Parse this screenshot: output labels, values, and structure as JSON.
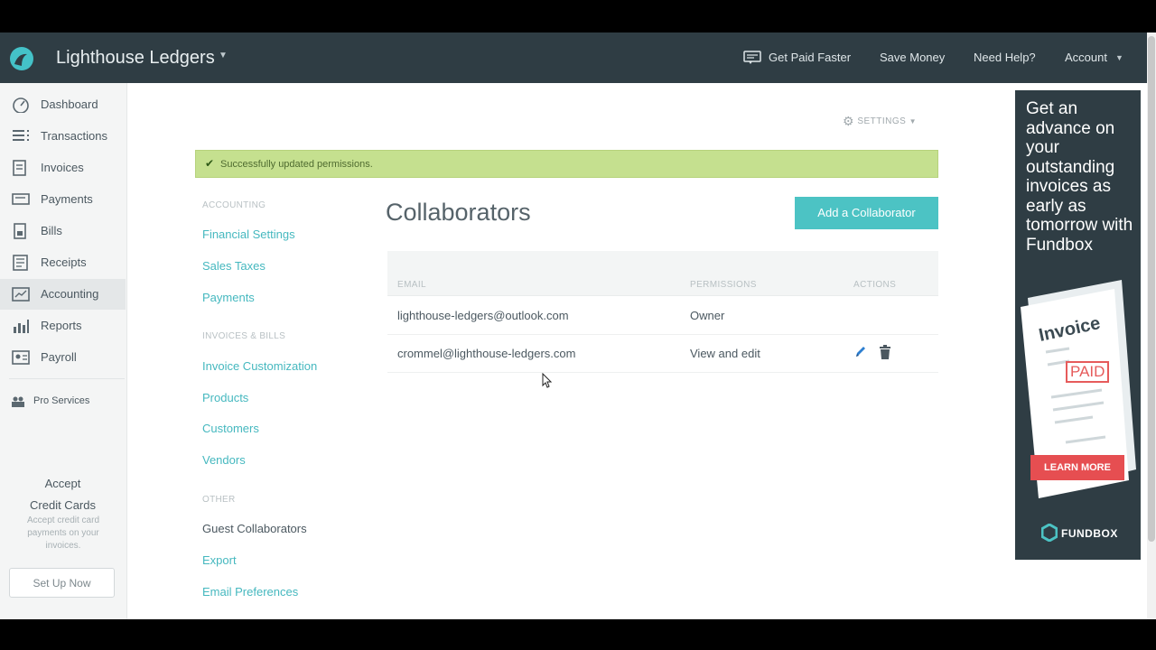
{
  "header": {
    "brand": "Lighthouse Ledgers",
    "links": {
      "get_paid": "Get Paid Faster",
      "save_money": "Save Money",
      "help": "Need Help?",
      "account": "Account"
    }
  },
  "sidebar": {
    "items": [
      {
        "label": "Dashboard",
        "icon": "dashboard-icon"
      },
      {
        "label": "Transactions",
        "icon": "transactions-icon"
      },
      {
        "label": "Invoices",
        "icon": "invoices-icon"
      },
      {
        "label": "Payments",
        "icon": "payments-icon"
      },
      {
        "label": "Bills",
        "icon": "bills-icon"
      },
      {
        "label": "Receipts",
        "icon": "receipts-icon"
      },
      {
        "label": "Accounting",
        "icon": "accounting-icon",
        "active": true
      },
      {
        "label": "Reports",
        "icon": "reports-icon"
      },
      {
        "label": "Payroll",
        "icon": "payroll-icon"
      }
    ],
    "pro_services": "Pro Services",
    "promo": {
      "title_line1": "Accept",
      "title_line2": "Credit Cards",
      "description": "Accept credit card payments on your invoices.",
      "button": "Set Up Now"
    }
  },
  "settings_label": "SETTINGS",
  "alert": {
    "text": "Successfully updated permissions.",
    "color": "#c5e08f"
  },
  "subnav": {
    "accounting_head": "ACCOUNTING",
    "accounting": [
      "Financial Settings",
      "Sales Taxes",
      "Payments"
    ],
    "invoices_head": "INVOICES & BILLS",
    "invoices": [
      "Invoice Customization",
      "Products",
      "Customers",
      "Vendors"
    ],
    "other_head": "OTHER",
    "other": [
      "Guest Collaborators",
      "Export",
      "Email Preferences"
    ]
  },
  "main": {
    "title": "Collaborators",
    "add_button": "Add a Collaborator",
    "table": {
      "headers": [
        "EMAIL",
        "PERMISSIONS",
        "ACTIONS"
      ],
      "rows": [
        {
          "email": "lighthouse-ledgers@outlook.com",
          "permission": "Owner"
        },
        {
          "email": "crommel@lighthouse-ledgers.com",
          "permission": "View and edit"
        }
      ]
    }
  },
  "ad": {
    "headline": "Get an advance on your outstanding invoices as early as tomorrow with Fundbox",
    "invoice_label": "Invoice",
    "paid_label": "PAID",
    "button": "LEARN MORE",
    "logo": "FUNDBOX"
  },
  "colors": {
    "topbar": "#2f3d44",
    "accent": "#4cc3c4",
    "link": "#45b8bf",
    "ad_button": "#e64e51"
  }
}
